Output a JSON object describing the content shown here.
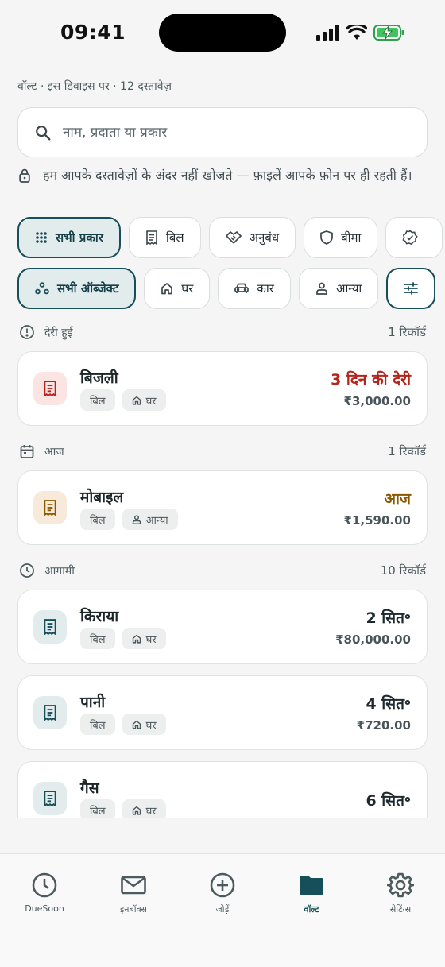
{
  "status_bar": {
    "time": "09:41"
  },
  "header": {
    "caption": "वॉल्ट · इस डिवाइस पर · 12 दस्तावेज़"
  },
  "search": {
    "placeholder": "नाम, प्रदाता या प्रकार"
  },
  "privacy_note": "हम आपके दस्तावेज़ों के अंदर नहीं खोजते — फ़ाइलें आपके फ़ोन पर ही रहती हैं।",
  "type_filters": [
    {
      "label": "सभी प्रकार",
      "icon": "grid-icon",
      "active": true
    },
    {
      "label": "बिल",
      "icon": "receipt-icon"
    },
    {
      "label": "अनुबंध",
      "icon": "handshake-icon"
    },
    {
      "label": "बीमा",
      "icon": "shield-icon"
    },
    {
      "label": "",
      "icon": "verified-badge-icon"
    }
  ],
  "object_filters": [
    {
      "label": "सभी ऑब्जेक्ट",
      "icon": "nodes-icon",
      "active": true
    },
    {
      "label": "घर",
      "icon": "home-icon"
    },
    {
      "label": "कार",
      "icon": "car-icon"
    },
    {
      "label": "आन्या",
      "icon": "person-icon"
    },
    {
      "label": "",
      "icon": "sliders-icon"
    }
  ],
  "groups": [
    {
      "title": "देरी हुई",
      "count": "1 रिकॉर्ड",
      "icon": "alert-circle-icon",
      "items": [
        {
          "title": "बिजली",
          "tags": [
            "बिल",
            "घर"
          ],
          "due": "3 दिन की देरी",
          "amount": "₹3,000.00",
          "color": "#b3261e"
        }
      ]
    },
    {
      "title": "आज",
      "count": "1 रिकॉर्ड",
      "icon": "calendar-icon",
      "items": [
        {
          "title": "मोबाइल",
          "tags": [
            "बिल",
            "आन्या"
          ],
          "due": "आज",
          "amount": "₹1,590.00",
          "color": "#8a5a00"
        }
      ]
    },
    {
      "title": "आगामी",
      "count": "10 रिकॉर्ड",
      "icon": "clock-icon",
      "items": [
        {
          "title": "किराया",
          "tags": [
            "बिल",
            "घर"
          ],
          "due": "2 सित॰",
          "amount": "₹80,000.00",
          "color": "#1c2528"
        },
        {
          "title": "पानी",
          "tags": [
            "बिल",
            "घर"
          ],
          "due": "4 सित॰",
          "amount": "₹720.00",
          "color": "#1c2528"
        },
        {
          "title": "गैस",
          "tags": [
            "बिल",
            "घर"
          ],
          "due": "6 सित॰",
          "amount": "",
          "color": "#1c2528"
        }
      ]
    }
  ],
  "tabs": [
    {
      "label": "DueSoon",
      "icon": "clock-icon"
    },
    {
      "label": "इनबॉक्स",
      "icon": "mail-icon"
    },
    {
      "label": "जोड़ें",
      "icon": "add-circle-icon"
    },
    {
      "label": "वॉल्ट",
      "icon": "folder-icon",
      "active": true
    },
    {
      "label": "सेटिंग्स",
      "icon": "gear-icon"
    }
  ],
  "colors": {
    "accent": "#164e5a",
    "overdue": "#b3261e",
    "today": "#8a5a00",
    "background": "#f4f5f4"
  }
}
